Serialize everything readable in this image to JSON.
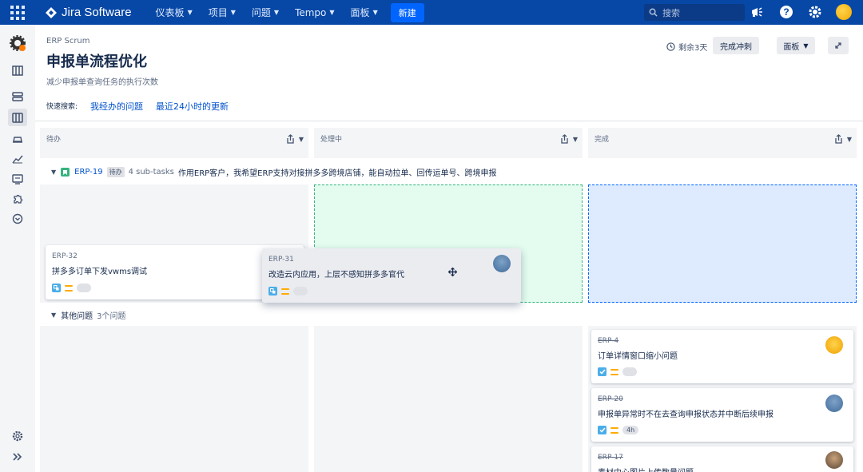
{
  "topnav": {
    "product": "Jira Software",
    "items": [
      {
        "label": "仪表板"
      },
      {
        "label": "项目"
      },
      {
        "label": "问题"
      },
      {
        "label": "Tempo"
      },
      {
        "label": "面板"
      }
    ],
    "create_label": "新建",
    "search_placeholder": "搜索"
  },
  "header": {
    "project": "ERP Scrum",
    "title": "申报单流程优化",
    "subtitle": "减少申报单查询任务的执行次数",
    "quick_filters_label": "快速搜索:",
    "quick_filters": [
      "我经办的问题",
      "最近24小时的更新"
    ],
    "remaining": "剩余3天",
    "complete_sprint": "完成冲刺",
    "board_label": "面板"
  },
  "columns": [
    {
      "label": "待办"
    },
    {
      "label": "处理中"
    },
    {
      "label": "完成"
    }
  ],
  "swimlanes": {
    "parent": {
      "key": "ERP-19",
      "status": "待办",
      "subtasks": "4 sub-tasks",
      "summary": "作用ERP客户，我希望ERP支持对接拼多多跨境店铺，能自动拉单、回传运单号、跨境申报"
    },
    "other": {
      "label": "其他问题",
      "count": "3个问题"
    }
  },
  "cards": {
    "erp32": {
      "key": "ERP-32",
      "summary": "拼多多订单下发vwms调试"
    },
    "erp31": {
      "key": "ERP-31",
      "summary": "改造云内应用，上层不感知拼多多官代"
    },
    "erp4": {
      "key": "ERP-4",
      "summary": "订单详情窗口缩小问题"
    },
    "erp20": {
      "key": "ERP-20",
      "summary": "申报单异常时不在去查询申报状态并中断后续申报",
      "estimate": "4h"
    },
    "erp17": {
      "key": "ERP-17",
      "summary": "素材中心图片上传数量问题"
    }
  }
}
